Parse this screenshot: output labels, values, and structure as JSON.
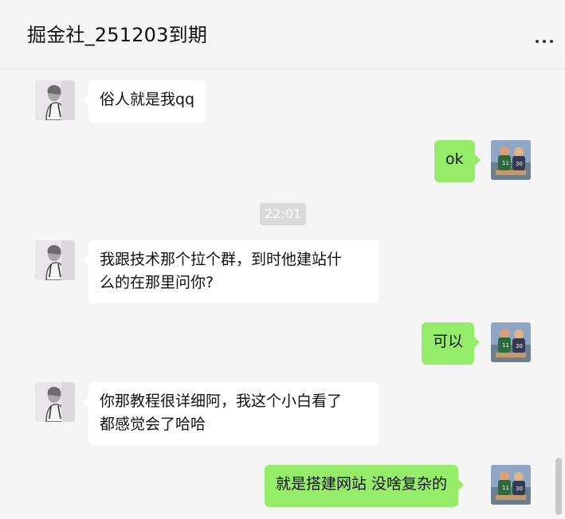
{
  "header": {
    "title": "掘金社_251203到期",
    "more_icon": "more-horizontal-icon"
  },
  "colors": {
    "background": "#f5f5f5",
    "incoming_bubble": "#ffffff",
    "outgoing_bubble": "#95ec69",
    "timestamp_badge": "#dadada"
  },
  "messages": [
    {
      "from": "other",
      "text": "俗人就是我qq"
    },
    {
      "from": "me",
      "text": "ok"
    },
    {
      "from": "system",
      "time": "22:01"
    },
    {
      "from": "other",
      "line1": "我跟技术那个拉个群，到时他建站什",
      "line2": "么的在那里问你?"
    },
    {
      "from": "me",
      "text": "可以"
    },
    {
      "from": "other",
      "line1": "你那教程很详细阿，我这个小白看了",
      "line2": "都感觉会了哈哈"
    },
    {
      "from": "me",
      "text": "就是搭建网站 没啥复杂的"
    }
  ]
}
